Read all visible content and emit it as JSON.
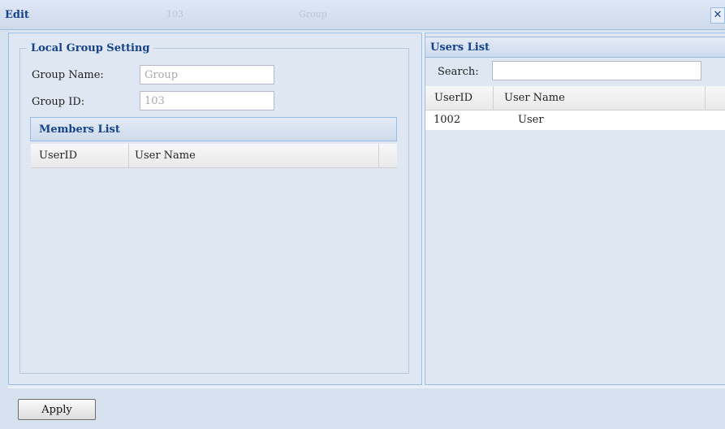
{
  "window": {
    "title": "Edit",
    "bg_id": "103",
    "bg_name": "Group",
    "close_glyph": "✕"
  },
  "local_group": {
    "legend": "Local Group Setting",
    "group_name_label": "Group Name:",
    "group_name_value": "Group",
    "group_id_label": "Group ID:",
    "group_id_value": "103"
  },
  "members_list": {
    "title": "Members List",
    "columns": [
      "UserID",
      "User Name"
    ],
    "rows": []
  },
  "users_list": {
    "title": "Users List",
    "search_label": "Search:",
    "search_value": "",
    "columns": [
      "UserID",
      "User Name"
    ],
    "rows": [
      {
        "user_id": "1002",
        "user_name": "User"
      }
    ]
  },
  "actions": {
    "apply_label": "Apply"
  },
  "colors": {
    "header_text": "#15428b",
    "panel_border": "#99bbe8",
    "panel_bg": "#dfe7f2"
  }
}
